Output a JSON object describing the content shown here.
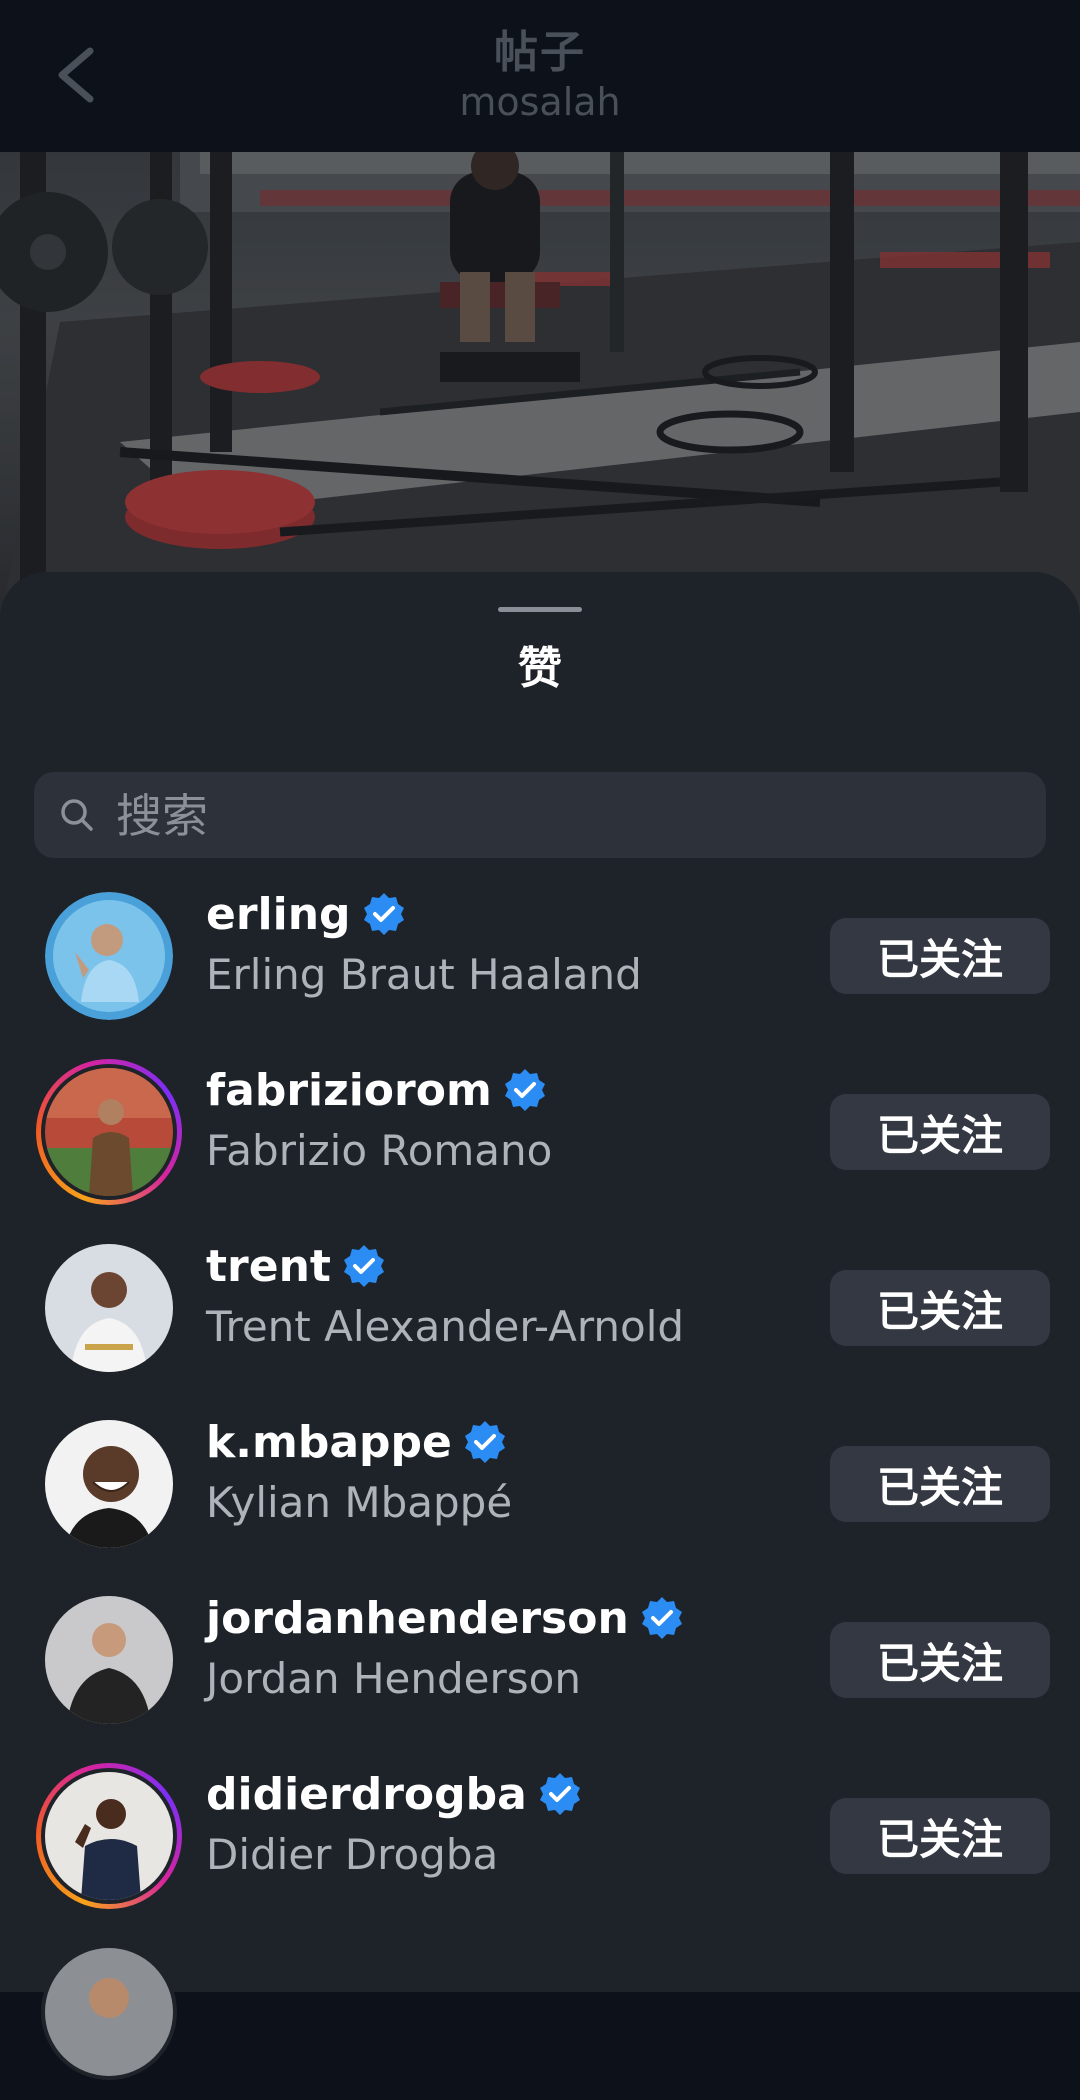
{
  "header": {
    "title": "帖子",
    "subtitle": "mosalah"
  },
  "sheet": {
    "title": "赞"
  },
  "search": {
    "placeholder": "搜索",
    "value": ""
  },
  "icons": {
    "back": "chevron-left-icon",
    "search": "search-icon",
    "verified": "verified-badge-icon"
  },
  "colors": {
    "verified": "#2b8cf4",
    "follow_button_bg": "#333842",
    "sheet_bg": "#1e2229",
    "story_ring": "#d6249f"
  },
  "users": [
    {
      "username": "erling",
      "full_name": "Erling Braut Haaland",
      "button": "已关注",
      "verified": true,
      "story_ring": false
    },
    {
      "username": "fabriziorom",
      "full_name": "Fabrizio Romano",
      "button": "已关注",
      "verified": true,
      "story_ring": true
    },
    {
      "username": "trent",
      "full_name": "Trent Alexander-Arnold",
      "button": "已关注",
      "verified": true,
      "story_ring": false
    },
    {
      "username": "k.mbappe",
      "full_name": "Kylian Mbappé",
      "button": "已关注",
      "verified": true,
      "story_ring": false
    },
    {
      "username": "jordanhenderson",
      "full_name": "Jordan Henderson",
      "button": "已关注",
      "verified": true,
      "story_ring": false
    },
    {
      "username": "didierdrogba",
      "full_name": "Didier Drogba",
      "button": "已关注",
      "verified": true,
      "story_ring": true
    }
  ]
}
